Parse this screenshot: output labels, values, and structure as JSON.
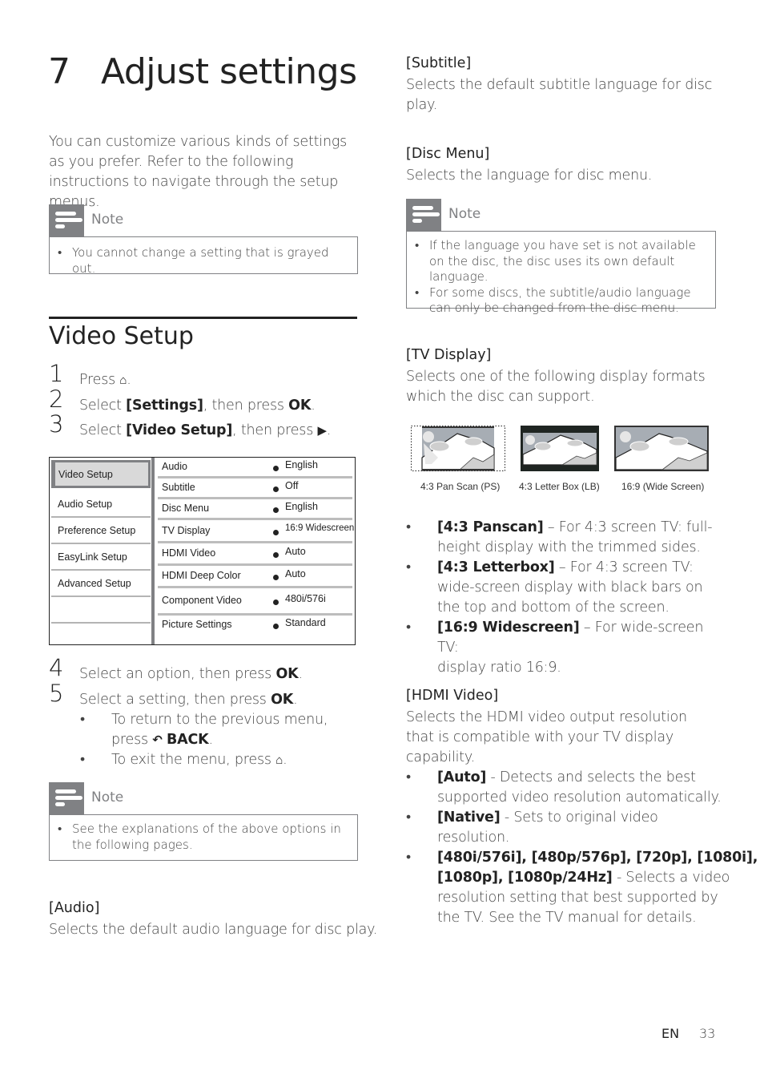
{
  "chapter": {
    "number": "7",
    "title": "Adjust settings"
  },
  "intro": "You can customize various kinds of settings as you prefer. Refer to the following instructions to navigate through the setup menus.",
  "note_label": "Note",
  "notes": {
    "grayed": [
      "You cannot change a setting that is grayed out."
    ],
    "explanations": [
      "See the explanations of the above options in the following pages."
    ],
    "language": [
      "If the language you have set is not available on the disc, the disc uses its own default language.",
      "For some discs, the subtitle/audio language can only be changed from the disc menu."
    ]
  },
  "section": {
    "title": "Video Setup"
  },
  "steps": [
    {
      "num": "1",
      "pre": "Press ",
      "bold": "",
      "post": "",
      "icon": "home-icon",
      "end": "."
    },
    {
      "num": "2",
      "pre": "Select ",
      "bold": "[Settings]",
      "post": ", then press ",
      "bold2": "OK",
      "end": "."
    },
    {
      "num": "3",
      "pre": "Select ",
      "bold": "[Video Setup]",
      "post": ", then press ",
      "icon": "play-right-icon",
      "end": "."
    },
    {
      "num": "4",
      "pre": "Select an option, then press ",
      "bold": "OK",
      "end": "."
    },
    {
      "num": "5",
      "pre": "Select a setting, then press ",
      "bold": "OK",
      "end": "."
    }
  ],
  "step5_bullets": [
    {
      "line1": "To return to the previous menu,",
      "line2_pre": "press ",
      "line2_bold": "BACK",
      "line2_end": ".",
      "icon": "back-icon"
    },
    {
      "line1_pre": "To exit the menu, press ",
      "icon": "home-icon",
      "end": "."
    }
  ],
  "setup_menu": {
    "categories": [
      "Video Setup",
      "Audio Setup",
      "Preference Setup",
      "EasyLink Setup",
      "Advanced Setup",
      "",
      ""
    ],
    "selected": "Video Setup",
    "options": [
      {
        "label": "Audio",
        "value": "English"
      },
      {
        "label": "Subtitle",
        "value": "Off"
      },
      {
        "label": "Disc Menu",
        "value": "English"
      },
      {
        "label": "TV Display",
        "value": "16:9 Widescreen"
      },
      {
        "label": "HDMI Video",
        "value": "Auto"
      },
      {
        "label": "HDMI Deep Color",
        "value": "Auto"
      },
      {
        "label": "Component Video",
        "value": "480i/576i"
      },
      {
        "label": "Picture Settings",
        "value": "Standard"
      }
    ]
  },
  "audio": {
    "heading": "[Audio]",
    "desc": "Selects the default audio language for disc play."
  },
  "subtitle": {
    "heading": "[Subtitle]",
    "desc_l1": "Selects the default subtitle language for disc",
    "desc_l2": "play."
  },
  "disc_menu": {
    "heading": "[Disc Menu]",
    "desc": "Selects the language for disc menu."
  },
  "tv_display": {
    "heading": "[TV Display]",
    "desc_l1": "Selects one of the following display formats",
    "desc_l2": "which the disc can support.",
    "images": [
      {
        "caption": "4:3 Pan Scan (PS)"
      },
      {
        "caption": "4:3 Letter Box (LB)"
      },
      {
        "caption": "16:9 (Wide Screen)"
      }
    ],
    "options": [
      {
        "bold": "[4:3 Panscan]",
        "l1": " – For 4:3 screen TV: full-",
        "l2": "height display with the trimmed sides."
      },
      {
        "bold": "[4:3 Letterbox]",
        "l1": " – For 4:3 screen TV:",
        "l2": "wide-screen display with black bars on",
        "l3": "the top and bottom of the screen."
      },
      {
        "bold": "[16:9 Widescreen]",
        "l1": " – For wide-screen TV:",
        "l2": "display ratio 16:9."
      }
    ]
  },
  "hdmi_video": {
    "heading": "[HDMI Video]",
    "desc_l1": "Selects the HDMI video output resolution",
    "desc_l2": "that is compatible with your TV display",
    "desc_l3": "capability.",
    "options": [
      {
        "bold": "[Auto]",
        "l1": " - Detects and selects the best",
        "l2": "supported video resolution automatically."
      },
      {
        "bold": "[Native]",
        "l1": " - Sets to original video",
        "l2": "resolution."
      },
      {
        "bold1": "[480i/576i], [480p/576p], [720p], [1080i],",
        "bold2": "[1080p], [1080p/24Hz]",
        "l2": " - Selects a video",
        "l3": "resolution setting that best supported by",
        "l4": "the TV. See the TV manual for details."
      }
    ]
  },
  "footer": {
    "lang": "EN",
    "page": "33"
  }
}
